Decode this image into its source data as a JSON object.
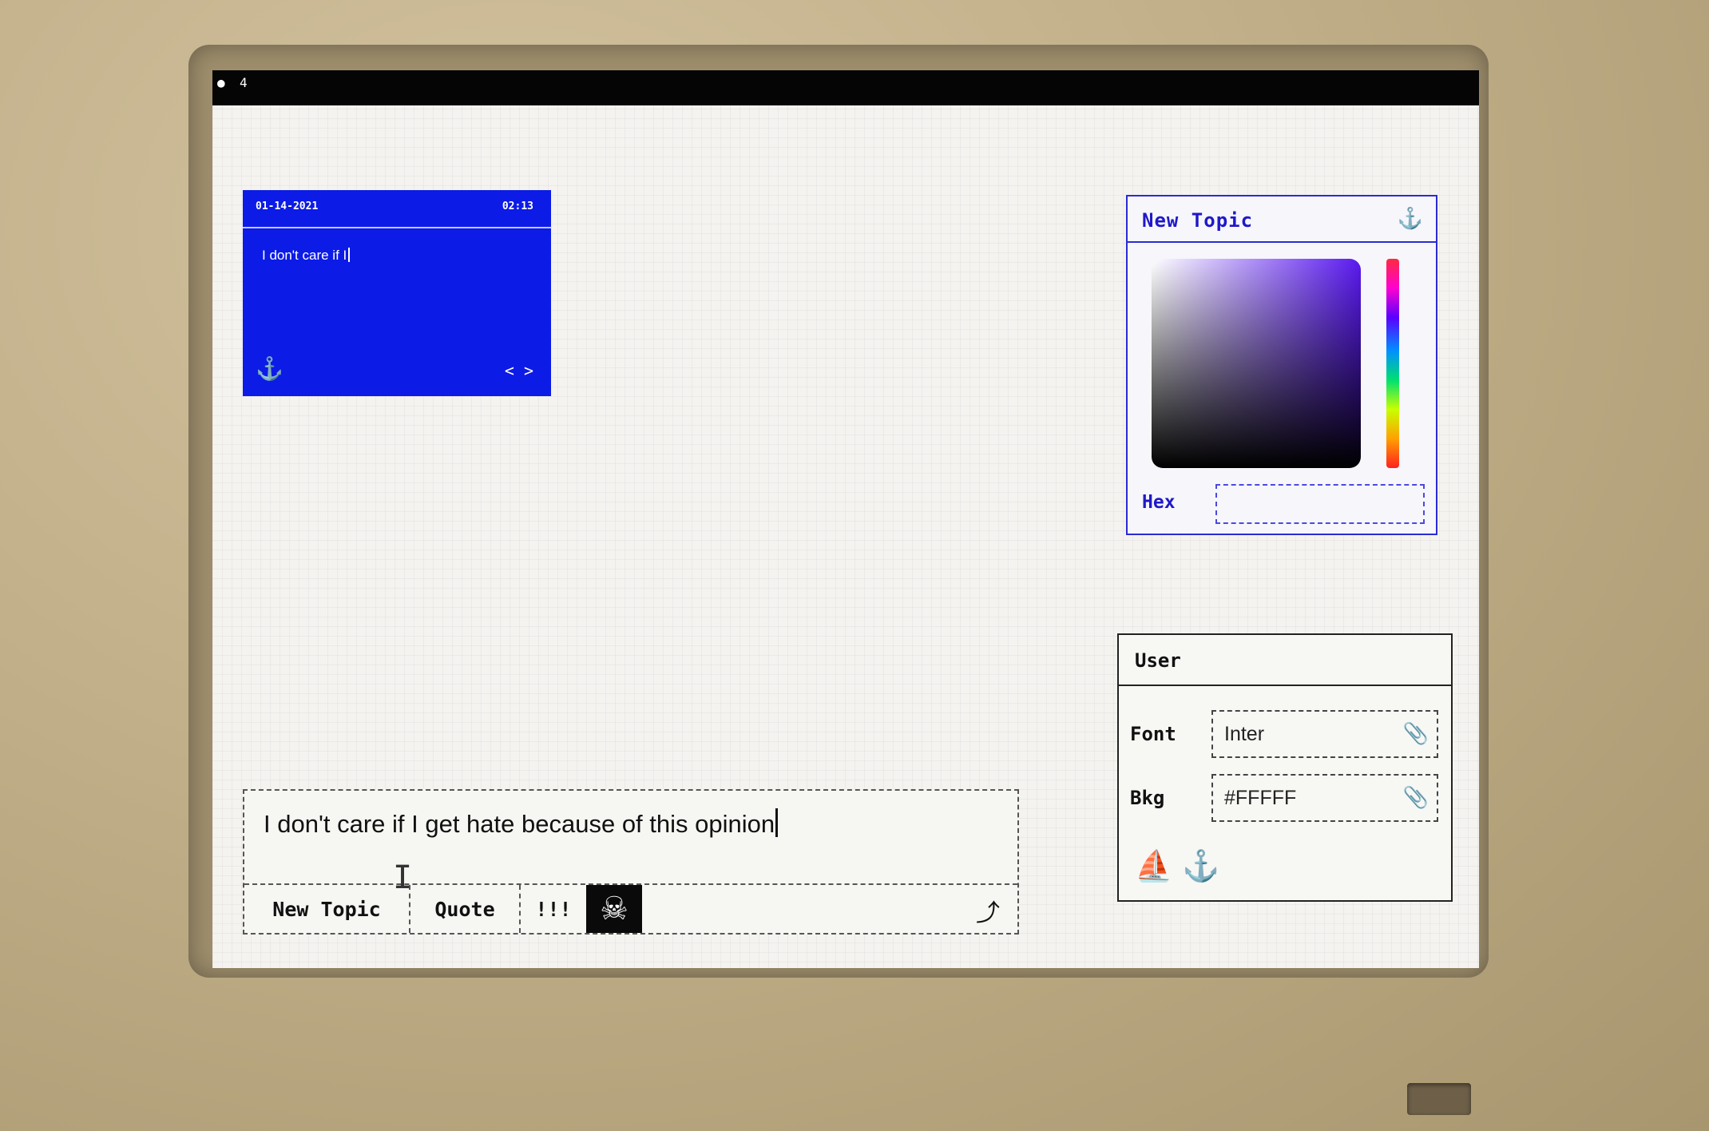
{
  "menubar": {
    "apple": "●",
    "item": "4"
  },
  "note": {
    "date": "01-14-2021",
    "time": "02:13",
    "text": "I don't care if I",
    "anchor_icon": "⚓",
    "code_icon": "< >"
  },
  "color_panel": {
    "title": "New Topic",
    "anchor_icon": "⚓",
    "hex_label": "Hex",
    "hex_value": ""
  },
  "user_panel": {
    "title": "User",
    "font_label": "Font",
    "font_value": "Inter",
    "bkg_label": "Bkg",
    "bkg_value": "#FFFFF",
    "attach_icon": "📎",
    "boat_icon": "⛵",
    "anchor_icon": "⚓"
  },
  "composer": {
    "text": "I don't care if I get hate because of this opinion",
    "buttons": [
      "New Topic",
      "Quote",
      "!!!"
    ],
    "skull_icon": "☠",
    "share_icon": "⤴"
  }
}
